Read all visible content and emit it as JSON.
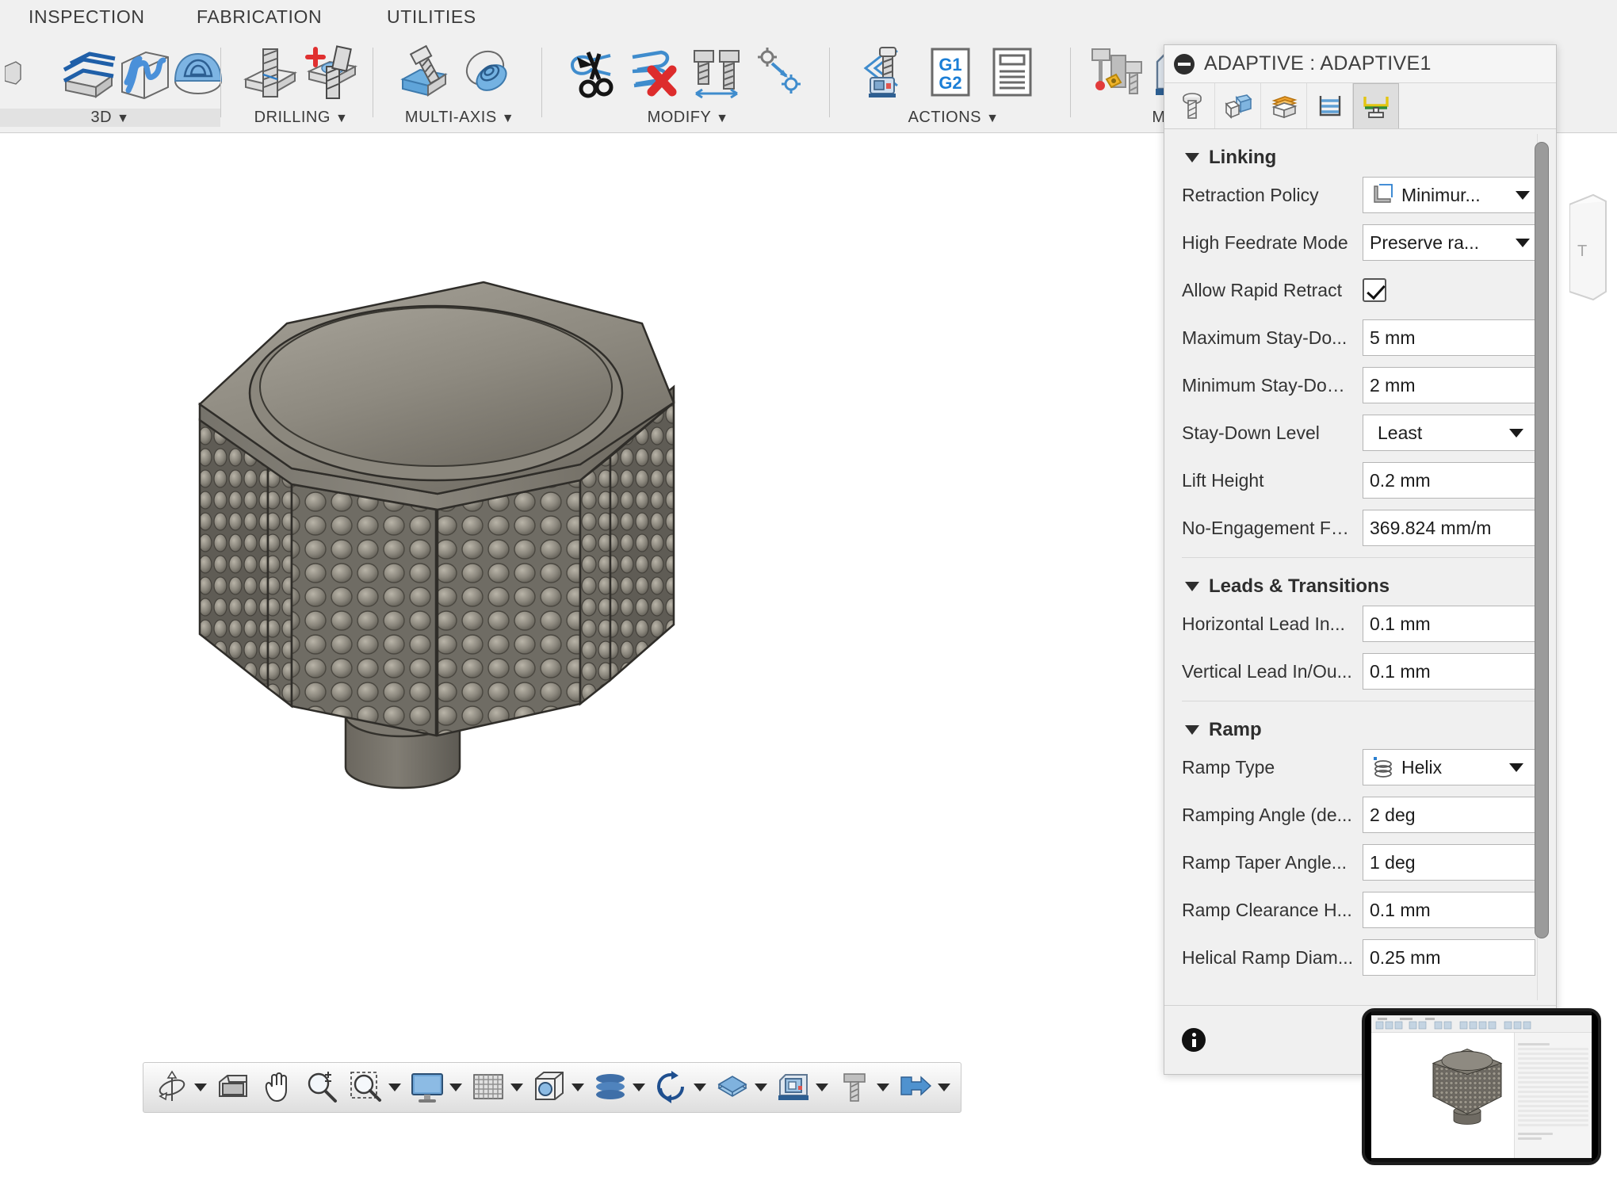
{
  "app": {
    "accent_color": "#e8a13a",
    "canvas_bg": "#ffffff"
  },
  "ribbon": {
    "tabs": [
      {
        "label": "INSPECTION",
        "name": "tab-inspection"
      },
      {
        "label": "FABRICATION",
        "name": "tab-fabrication"
      },
      {
        "label": "UTILITIES",
        "name": "tab-utilities"
      }
    ],
    "panels": [
      {
        "label": "3D",
        "has_caret": true,
        "highlighted": true,
        "icons": [
          "parallel-faces-icon",
          "pocket-clearing-icon",
          "scallop-3d-icon"
        ]
      },
      {
        "label": "DRILLING",
        "has_caret": true,
        "highlighted": false,
        "icons": [
          "drill-icon",
          "drill-add-icon"
        ]
      },
      {
        "label": "MULTI-AXIS",
        "has_caret": true,
        "highlighted": false,
        "icons": [
          "multi-axis-contour-icon",
          "multi-axis-swarf-icon"
        ]
      },
      {
        "label": "MODIFY",
        "has_caret": true,
        "highlighted": false,
        "icons": [
          "trim-toolpath-icon",
          "delete-toolpath-icon",
          "tool-compare-icon",
          "move-point-icon"
        ]
      },
      {
        "label": "ACTIONS",
        "has_caret": true,
        "highlighted": false,
        "icons": [
          "simulate-icon",
          "post-process-g1g2-icon",
          "setup-sheet-icon"
        ]
      },
      {
        "label": "M",
        "has_caret": false,
        "highlighted": false,
        "icons": [
          "tool-library-icon",
          "machine-library-icon"
        ]
      }
    ]
  },
  "model": {
    "name": "knurled-octagonal-knob",
    "description": "Shaded 3D CAM model of a knurled octagonal knob with dimpled side faces and a round boss at the base"
  },
  "dialog": {
    "title": "ADAPTIVE : ADAPTIVE1",
    "collapse_icon": "minus-circle-icon",
    "tabs": [
      {
        "name": "tool-tab",
        "icon": "tool-icon",
        "active": false
      },
      {
        "name": "geometry-tab",
        "icon": "geometry-icon",
        "active": false
      },
      {
        "name": "heights-tab",
        "icon": "heights-icon",
        "active": false
      },
      {
        "name": "passes-tab",
        "icon": "passes-icon",
        "active": false
      },
      {
        "name": "linking-tab",
        "icon": "linking-icon",
        "active": true
      }
    ],
    "sections": [
      {
        "title": "Linking",
        "expanded": true,
        "rows": [
          {
            "label": "Retraction Policy",
            "type": "combo",
            "value": "Minimur...",
            "icon": "retract-policy-icon"
          },
          {
            "label": "High Feedrate Mode",
            "type": "combo",
            "value": "Preserve ra...",
            "icon": null
          },
          {
            "label": "Allow Rapid Retract",
            "type": "checkbox",
            "value": true
          },
          {
            "label": "Maximum Stay-Do...",
            "type": "text",
            "value": "5 mm"
          },
          {
            "label": "Minimum Stay-Do…",
            "type": "text",
            "value": "2 mm"
          },
          {
            "label": "Stay-Down Level",
            "type": "select",
            "value": "Least"
          },
          {
            "label": "Lift Height",
            "type": "text",
            "value": "0.2 mm"
          },
          {
            "label": "No-Engagement F…",
            "type": "text",
            "value": "369.824 mm/m"
          }
        ]
      },
      {
        "title": "Leads & Transitions",
        "expanded": true,
        "rows": [
          {
            "label": "Horizontal Lead In...",
            "type": "text",
            "value": "0.1 mm"
          },
          {
            "label": "Vertical Lead In/Ou...",
            "type": "text",
            "value": "0.1 mm"
          }
        ]
      },
      {
        "title": "Ramp",
        "expanded": true,
        "rows": [
          {
            "label": "Ramp Type",
            "type": "select",
            "value": "Helix",
            "icon": "helix-icon"
          },
          {
            "label": "Ramping Angle (de...",
            "type": "text",
            "value": "2 deg"
          },
          {
            "label": "Ramp Taper Angle...",
            "type": "text",
            "value": "1 deg"
          },
          {
            "label": "Ramp Clearance H...",
            "type": "text",
            "value": "0.1 mm"
          },
          {
            "label": "Helical Ramp Diam...",
            "type": "text",
            "value": "0.25 mm"
          }
        ]
      }
    ],
    "footer": {
      "info_icon": "info-icon",
      "buttons": [
        {
          "label": "",
          "name": "ok-button"
        }
      ]
    }
  },
  "navbar": {
    "items": [
      {
        "name": "orbit-button",
        "icon": "orbit-icon",
        "caret": true
      },
      {
        "name": "look-at-button",
        "icon": "look-at-icon",
        "caret": false
      },
      {
        "name": "pan-button",
        "icon": "pan-icon",
        "caret": false
      },
      {
        "name": "zoom-button",
        "icon": "zoom-icon",
        "caret": false
      },
      {
        "name": "zoom-window-button",
        "icon": "zoom-window-icon",
        "caret": true
      },
      {
        "name": "display-settings-button",
        "icon": "display-icon",
        "caret": true
      },
      {
        "name": "grid-snaps-button",
        "icon": "grid-icon",
        "caret": true
      },
      {
        "name": "viewports-button",
        "icon": "viewports-icon",
        "caret": true
      },
      {
        "name": "layers-button",
        "icon": "layers-icon",
        "caret": true
      },
      {
        "name": "refresh-button",
        "icon": "refresh-icon",
        "caret": true
      },
      {
        "name": "stock-button",
        "icon": "stock-icon",
        "caret": true
      },
      {
        "name": "machine-button",
        "icon": "machine-icon",
        "caret": true
      },
      {
        "name": "tool-button",
        "icon": "nav-tool-icon",
        "caret": true
      },
      {
        "name": "toolpath-button",
        "icon": "toolpath-icon",
        "caret": true
      }
    ]
  },
  "pip": {
    "name": "picture-in-picture-preview",
    "description": "Miniature screenshot of the same Fusion CAM window with the knob model and the parameter panel"
  }
}
